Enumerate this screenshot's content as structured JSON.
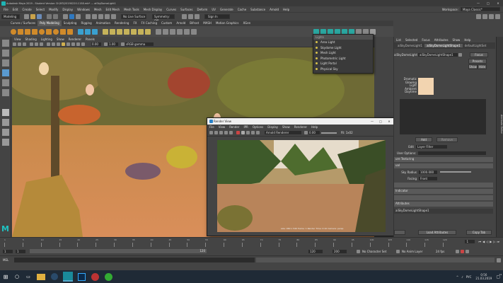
{
  "titlebar": {
    "title": "Autodesk Maya 2019 - Student Version: D:\\M3\\20190220.1158.mb* --- aiSkyDomeLight1",
    "minimize": "—",
    "maximize": "□",
    "close": "✕"
  },
  "menubar": {
    "items": [
      "File",
      "Edit",
      "Create",
      "Select",
      "Modify",
      "Display",
      "Windows",
      "Mesh",
      "Edit Mesh",
      "Mesh Tools",
      "Mesh Display",
      "Curves",
      "Surfaces",
      "Deform",
      "UV",
      "Generate",
      "Cache",
      "Substance",
      "Arnold",
      "Help"
    ],
    "workspace_label": "Workspace:",
    "workspace_value": "Maya Classic*"
  },
  "statusline": {
    "mode": "Modeling",
    "live_surface": "No Live Surface",
    "symmetry": "Symmetry: Off",
    "sign_in": "Sign In"
  },
  "shelf": {
    "tabs": [
      "Curves / Surfaces",
      "Poly Modeling",
      "Sculpting",
      "Rigging",
      "Animation",
      "Rendering",
      "FX",
      "FX Caching",
      "Custom",
      "Arnold",
      "Bifrost",
      "MASH",
      "Motion Graphics",
      "XGen"
    ],
    "active_tab": "Poly Modeling"
  },
  "viewport": {
    "menu": [
      "View",
      "Shading",
      "Lighting",
      "Show",
      "Renderer",
      "Panels"
    ],
    "field_a": "0.00",
    "field_b": "1.00",
    "colorspace": "sRGB gamma"
  },
  "lights_menu": {
    "header": "Lights",
    "items": [
      "Area Light",
      "Skydome Light",
      "Mesh Light",
      "Photometric Light",
      "Light Portal",
      "Physical Sky"
    ]
  },
  "attribute_editor": {
    "tabs": [
      "List",
      "Selected",
      "Focus",
      "Attributes",
      "Show",
      "Help"
    ],
    "node_tabs": [
      "aiSkyDomeLight1",
      "aiSkyDomeLightShape1",
      "defaultLightSet"
    ],
    "node_label": "aiSkyDomeLight:",
    "node_value": "aiSkyDomeLightShape1",
    "focus_btn": "Focus",
    "presets_btn": "Presets",
    "show_btn": "Show",
    "hide_btn": "Hide",
    "swatch_label_1": "Dramatic",
    "swatch_label_2": "Glowing",
    "swatch_label_3": "Light",
    "swatch_label_4": "Ambient",
    "swatch_label_5": "Daytime",
    "swatch_color": "#f2d4b0",
    "add_btn": "Add",
    "remove_btn": "Remove",
    "edit_label": "Edit",
    "edit_value": "Layer Filter",
    "user_options_label": "User Options:",
    "sections": [
      "ure Texturing",
      "ual",
      "",
      "Indicator",
      "",
      "Attributes"
    ],
    "sky_radius_label": "Sky Radius",
    "sky_radius_value": "1000.000",
    "facing_label": "Facing",
    "facing_value": "Front",
    "bottom_node": "aiSkyDomeLightShape1",
    "load_attributes": "Load Attributes",
    "copy_tab": "Copy Tab",
    "side_tab": "Attribute Editor"
  },
  "render_view": {
    "title": "Render View",
    "menu": [
      "File",
      "View",
      "Render",
      "IPR",
      "Options",
      "Display",
      "Show",
      "Renderer",
      "Help"
    ],
    "renderer": "Arnold Renderer",
    "exposure": "0.00",
    "zoom_text": "fit: 1x02",
    "footer": "size: 960 x 540 frame: 1 Render Time: 0:10 Camera: persp"
  },
  "timeline": {
    "ticks": [
      "1",
      "5",
      "10",
      "15",
      "20",
      "25",
      "30",
      "35",
      "40",
      "45",
      "50",
      "55",
      "60",
      "65",
      "70",
      "75",
      "80",
      "85",
      "90",
      "95",
      "100",
      "105",
      "110",
      "115",
      "120"
    ],
    "frame": "1"
  },
  "range": {
    "start": "1",
    "start2": "1",
    "slider_value": "120",
    "end": "120",
    "end2": "200",
    "character_set": "No Character Set",
    "anim_layer": "No Anim Layer",
    "fps": "24 fps"
  },
  "command_line": {
    "lang": "MEL"
  },
  "taskbar": {
    "lang": "РУС",
    "time": "0:56",
    "date": "21.03.2019",
    "notification": "14"
  }
}
